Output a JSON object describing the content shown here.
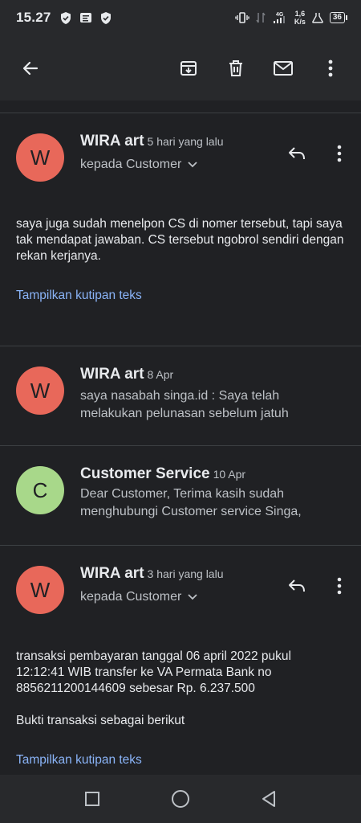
{
  "status_bar": {
    "time": "15.27",
    "network": "4G",
    "speed_value": "1,6",
    "speed_unit": "K/s",
    "battery": "36"
  },
  "toolbar": {
    "back_icon": "arrow-left-icon",
    "archive_icon": "archive-icon",
    "delete_icon": "trash-icon",
    "mark_unread_icon": "mail-icon",
    "more_icon": "more-vertical-icon"
  },
  "messages": [
    {
      "initial": "W",
      "avatar_color": "#e8685a",
      "sender": "WIRA art",
      "date": "5 hari yang lalu",
      "recipient": "kepada Customer",
      "body": "saya juga sudah menelpon CS di nomer tersebut, tapi saya tak mendapat jawaban. CS tersebut ngobrol sendiri dengan rekan kerjanya.",
      "quote_link": "Tampilkan kutipan teks"
    },
    {
      "initial": "W",
      "avatar_color": "#e8685a",
      "sender": "WIRA art",
      "date": "8 Apr",
      "snippet_line1": "saya nasabah singa.id : Saya telah",
      "snippet_line2": "melakukan pelunasan sebelum jatuh"
    },
    {
      "initial": "C",
      "avatar_color": "#a8d88a",
      "sender": "Customer Service",
      "date": "10 Apr",
      "snippet_line1": "Dear Customer, Terima kasih sudah",
      "snippet_line2": "menghubungi Customer service Singa,"
    },
    {
      "initial": "W",
      "avatar_color": "#e8685a",
      "sender": "WIRA art",
      "date": "3 hari yang lalu",
      "recipient": "kepada Customer",
      "body_line1": "transaksi pembayaran tanggal 06 april 2022 pukul",
      "body_line2": "12:12:41 WIB transfer ke VA Permata Bank no",
      "body_line3": "8856211200144609 sebesar Rp. 6.237.500",
      "body_line4": "Bukti transaksi sebagai berikut",
      "quote_link": "Tampilkan kutipan teks"
    }
  ],
  "nav_bar": {
    "recents_icon": "square-icon",
    "home_icon": "circle-icon",
    "back_icon": "triangle-back-icon"
  }
}
